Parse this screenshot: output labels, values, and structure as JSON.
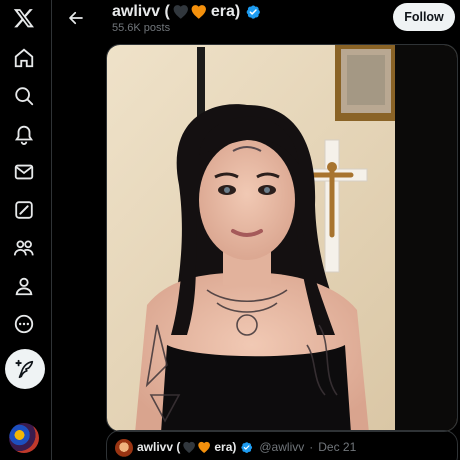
{
  "nav": {
    "items": [
      {
        "icon": "x-logo-icon"
      },
      {
        "icon": "home-icon"
      },
      {
        "icon": "explore-icon"
      },
      {
        "icon": "notifications-icon"
      },
      {
        "icon": "messages-icon"
      },
      {
        "icon": "grok-icon"
      },
      {
        "icon": "communities-icon"
      },
      {
        "icon": "profile-icon"
      },
      {
        "icon": "more-icon"
      }
    ],
    "compose_icon": "compose-feather-icon"
  },
  "header": {
    "name_prefix": "awlivv (",
    "hearts": [
      "black-heart",
      "orange-heart"
    ],
    "name_suffix": "era)",
    "posts_count": "55.6K posts",
    "follow_label": "Follow",
    "colors": {
      "verified": "#1d9bf0",
      "orange_heart": "#f4900c",
      "black_heart": "#31373d"
    }
  },
  "quote": {
    "name_prefix": "awlivv (",
    "name_suffix": "era)",
    "handle": "@awlivv",
    "separator": "·",
    "date": "Dec 21"
  }
}
